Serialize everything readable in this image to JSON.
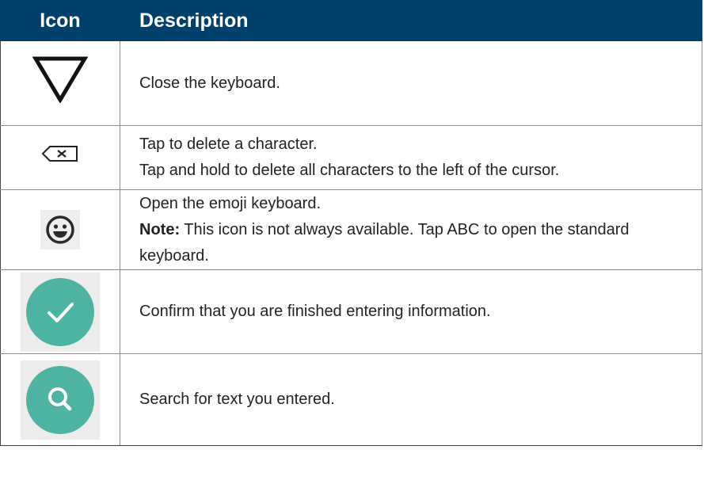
{
  "header": {
    "col_icon": "Icon",
    "col_description": "Description"
  },
  "rows": [
    {
      "icon": "close-keyboard-triangle-icon",
      "lines": [
        "Close the keyboard."
      ]
    },
    {
      "icon": "backspace-icon",
      "lines": [
        "Tap to delete a character.",
        "Tap and hold to delete all characters to the left of the cursor."
      ]
    },
    {
      "icon": "emoji-smiley-icon",
      "lines": [
        "Open the emoji keyboard."
      ],
      "note_label": "Note:",
      "note_text": " This icon is not always available. Tap ABC to open the standard keyboard."
    },
    {
      "icon": "confirm-check-icon",
      "lines": [
        "Confirm that you are finished entering information."
      ]
    },
    {
      "icon": "search-magnifier-icon",
      "lines": [
        "Search for text you entered."
      ]
    }
  ],
  "colors": {
    "header_bg": "#00416b",
    "header_text": "#ffffff",
    "teal": "#4fb3a3"
  }
}
